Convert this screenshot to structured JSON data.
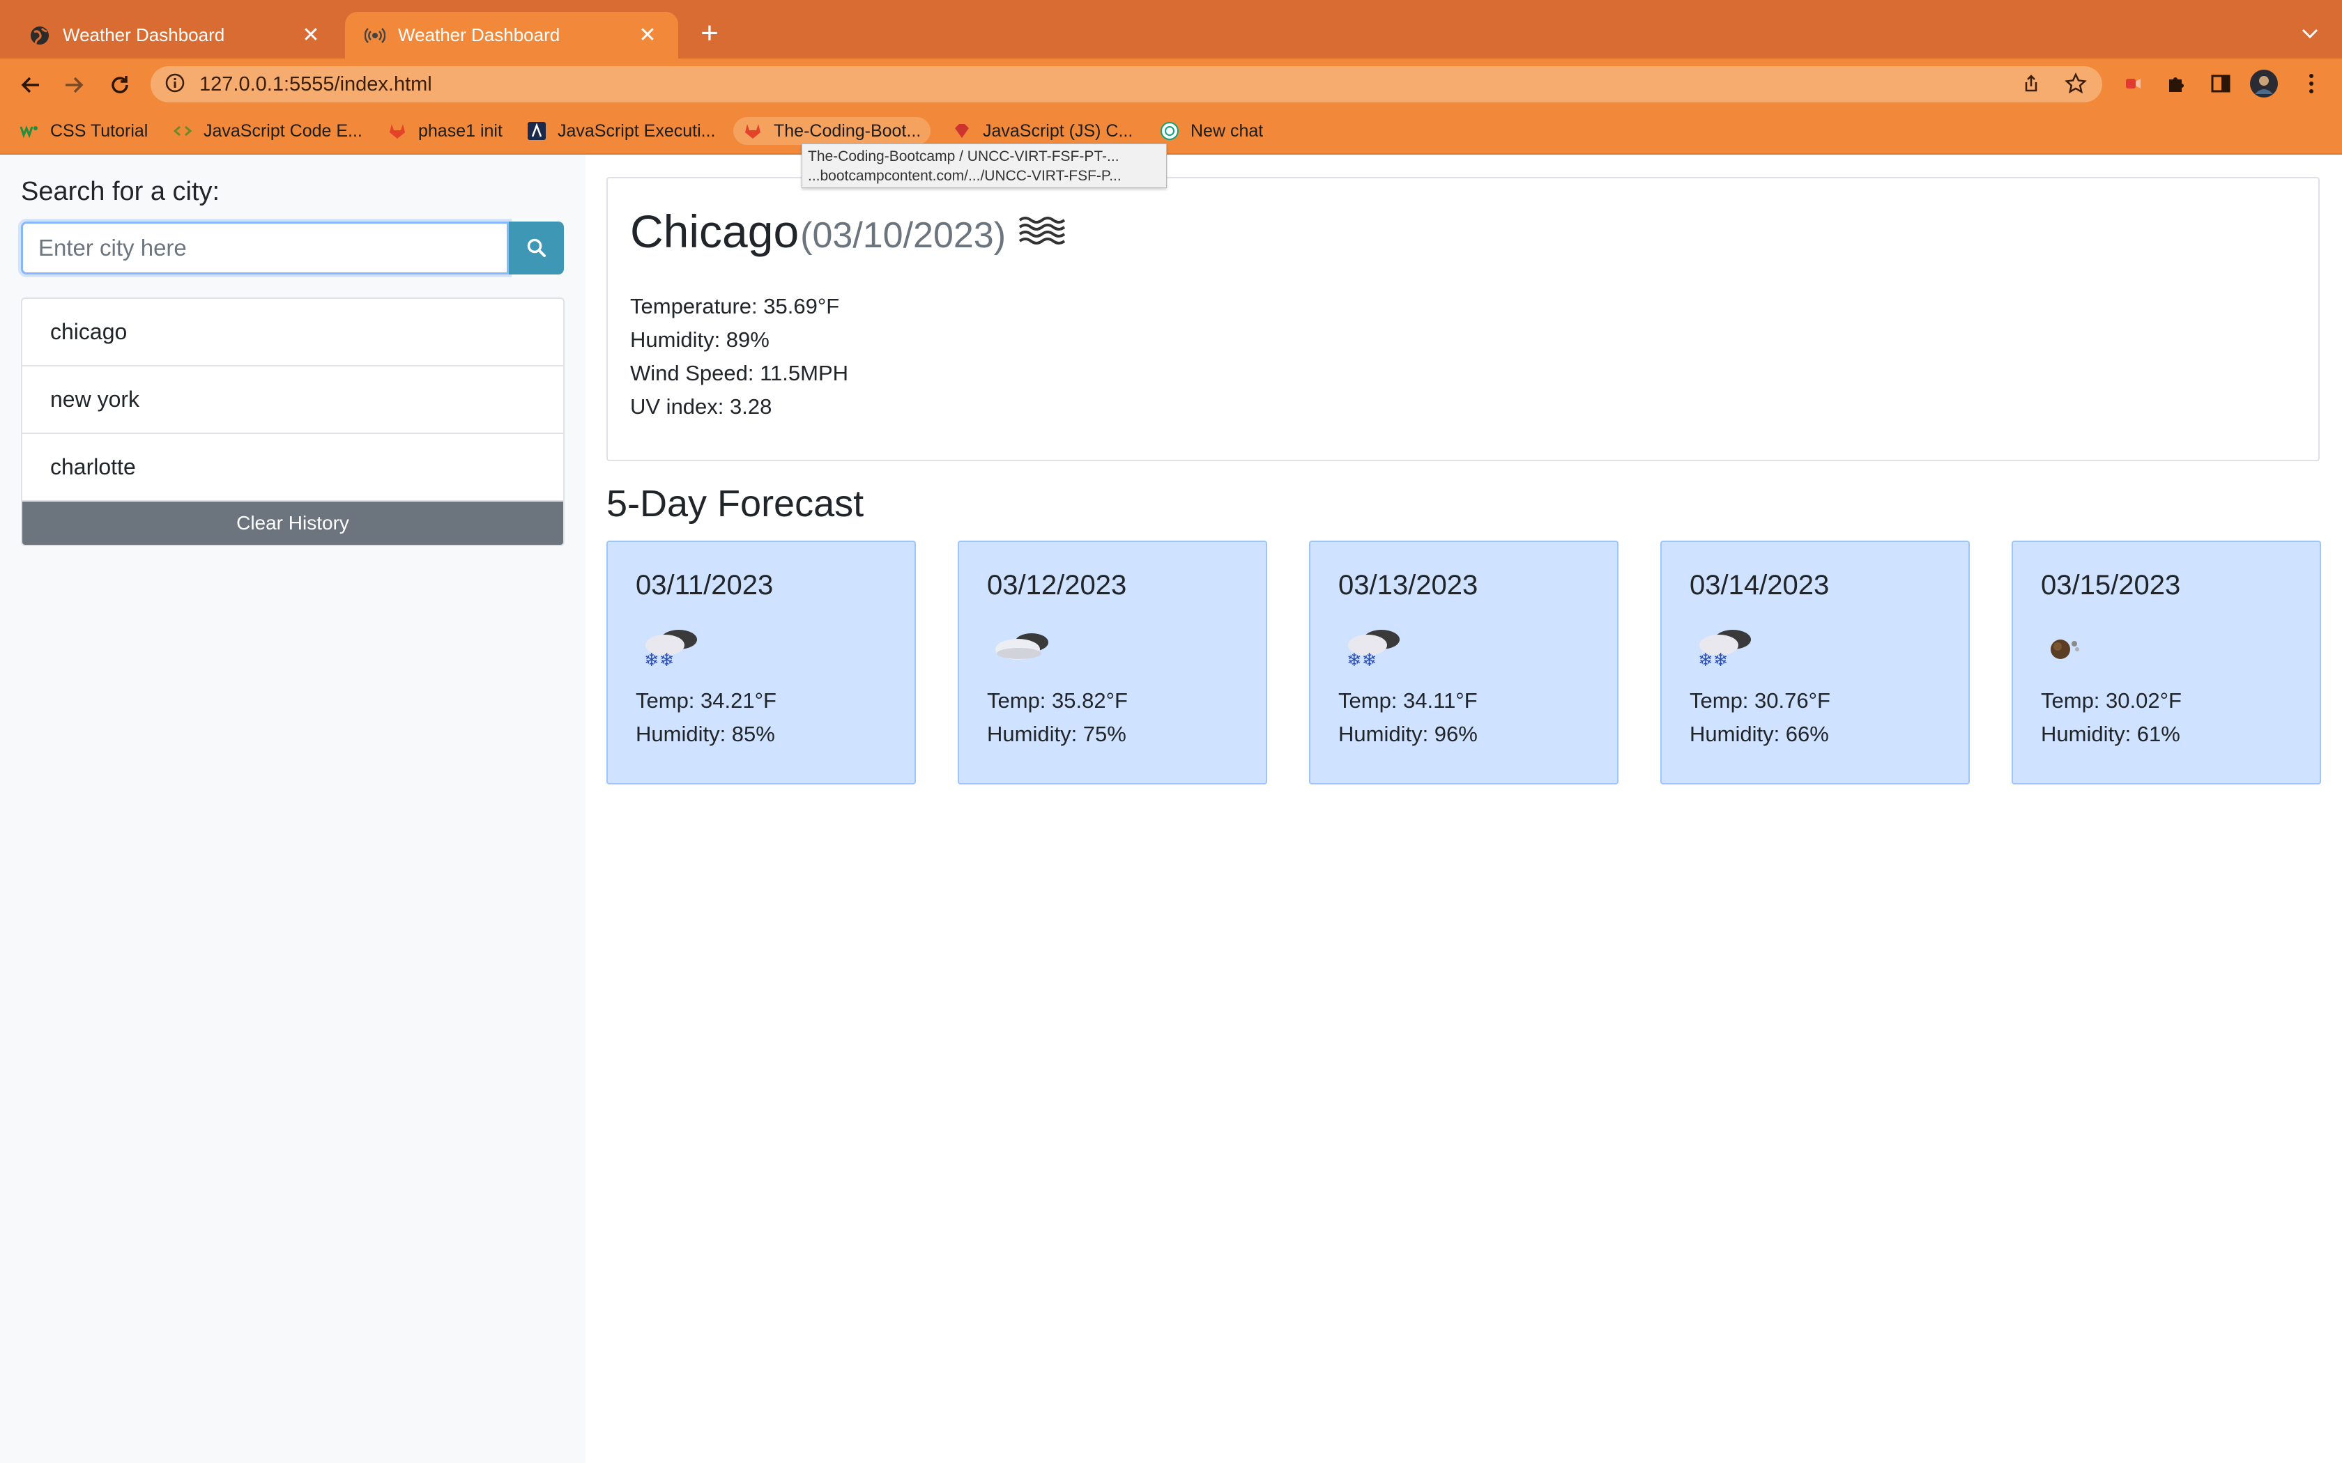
{
  "browser": {
    "tabs": [
      {
        "title": "Weather Dashboard",
        "icon": "globe-icon",
        "active": false
      },
      {
        "title": "Weather Dashboard",
        "icon": "broadcast-icon",
        "active": true
      }
    ],
    "url": "127.0.0.1:5555/index.html",
    "bookmarks": [
      {
        "label": "CSS Tutorial",
        "icon": "w3-icon"
      },
      {
        "label": "JavaScript Code E...",
        "icon": "code-icon"
      },
      {
        "label": "phase1 init",
        "icon": "gitlab-icon"
      },
      {
        "label": "JavaScript Executi...",
        "icon": "lambda-icon"
      },
      {
        "label": "The-Coding-Boot...",
        "icon": "gitlab-icon"
      },
      {
        "label": "JavaScript (JS) C...",
        "icon": "gem-icon"
      },
      {
        "label": "New chat",
        "icon": "chatgpt-icon"
      }
    ],
    "tooltip": {
      "line1": "The-Coding-Bootcamp / UNCC-VIRT-FSF-PT-...",
      "line2": "...bootcampcontent.com/.../UNCC-VIRT-FSF-P..."
    }
  },
  "sidebar": {
    "search_label": "Search for a city:",
    "search_placeholder": "Enter city here",
    "history": [
      "chicago",
      "new york",
      "charlotte"
    ],
    "clear_label": "Clear History"
  },
  "current": {
    "city": "Chicago",
    "date": "(03/10/2023)",
    "icon": "mist-icon",
    "temperature": "Temperature: 35.69°F",
    "humidity": "Humidity: 89%",
    "wind": "Wind Speed: 11.5MPH",
    "uv": "UV index: 3.28"
  },
  "forecast": {
    "title": "5-Day Forecast",
    "days": [
      {
        "date": "03/11/2023",
        "icon": "snow-cloud-icon",
        "temp": "Temp: 34.21°F",
        "humidity": "Humidity: 85%"
      },
      {
        "date": "03/12/2023",
        "icon": "cloud-icon",
        "temp": "Temp: 35.82°F",
        "humidity": "Humidity: 75%"
      },
      {
        "date": "03/13/2023",
        "icon": "snow-cloud-icon",
        "temp": "Temp: 34.11°F",
        "humidity": "Humidity: 96%"
      },
      {
        "date": "03/14/2023",
        "icon": "snow-cloud-icon",
        "temp": "Temp: 30.76°F",
        "humidity": "Humidity: 66%"
      },
      {
        "date": "03/15/2023",
        "icon": "moon-cloud-icon",
        "temp": "Temp: 30.02°F",
        "humidity": "Humidity: 61%"
      }
    ]
  },
  "colors": {
    "tab_bar": "#d96c32",
    "toolbar": "#f2893a",
    "search_button": "#3e97b4",
    "clear_button": "#6c757d",
    "card_background": "#cfe2ff"
  }
}
